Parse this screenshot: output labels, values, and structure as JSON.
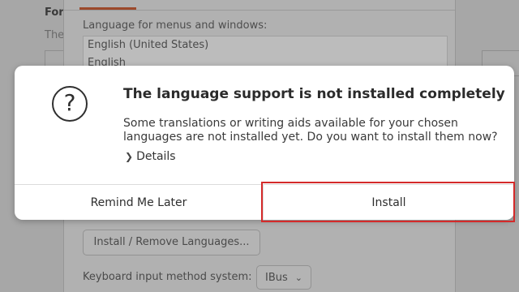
{
  "background": {
    "left_heading": "For",
    "left_sub": "The",
    "language_label": "Language for menus and windows:",
    "languages": [
      "English (United States)",
      "English"
    ],
    "install_remove_label": "Install / Remove Languages...",
    "keyboard_label": "Keyboard input method system:",
    "keyboard_value": "IBus"
  },
  "dialog": {
    "icon": "question-icon",
    "icon_glyph": "?",
    "title": "The language support is not installed completely",
    "body": "Some translations or writing aids available for your chosen languages are not installed yet. Do you want to install them now?",
    "details_label": "Details",
    "remind_label": "Remind Me Later",
    "install_label": "Install"
  },
  "colors": {
    "tab_indicator": "#9c4a2c",
    "highlight": "#d42a2a"
  }
}
